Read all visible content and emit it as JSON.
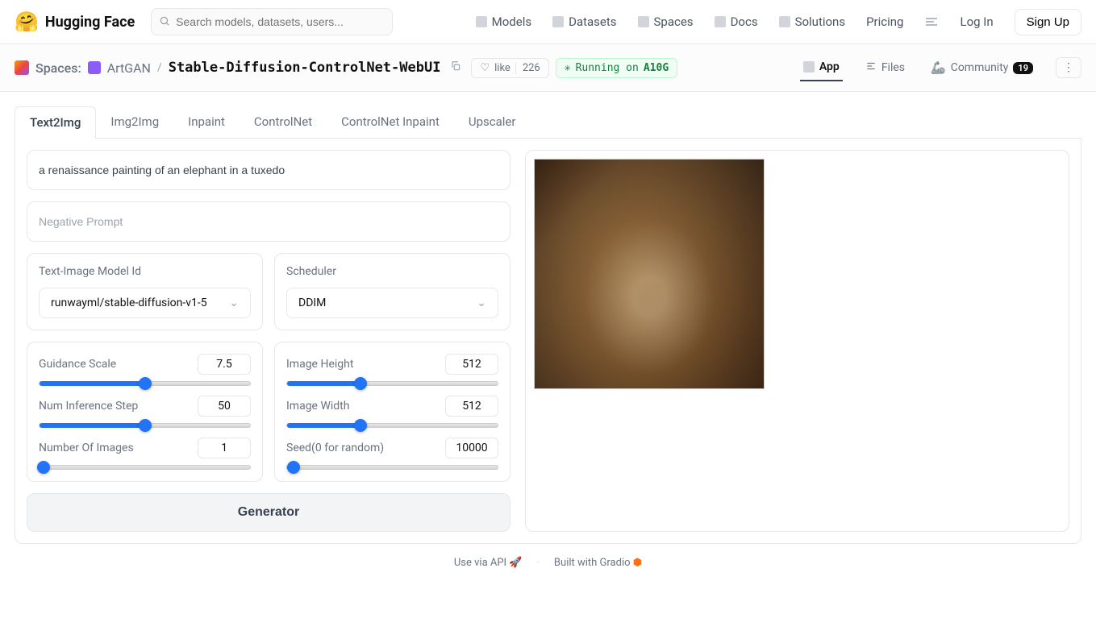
{
  "header": {
    "brand": "Hugging Face",
    "search_placeholder": "Search models, datasets, users...",
    "nav": {
      "models": "Models",
      "datasets": "Datasets",
      "spaces": "Spaces",
      "docs": "Docs",
      "solutions": "Solutions",
      "pricing": "Pricing",
      "login": "Log In",
      "signup": "Sign Up"
    }
  },
  "spacebar": {
    "label": "Spaces:",
    "owner": "ArtGAN",
    "name": "Stable-Diffusion-ControlNet-WebUI",
    "like_label": "like",
    "like_count": "226",
    "running_prefix": "Running on",
    "running_hw": "A10G",
    "tabs": {
      "app": "App",
      "files": "Files",
      "community": "Community",
      "community_count": "19"
    }
  },
  "tabs": {
    "text2img": "Text2Img",
    "img2img": "Img2Img",
    "inpaint": "Inpaint",
    "controlnet": "ControlNet",
    "controlnet_inpaint": "ControlNet Inpaint",
    "upscaler": "Upscaler"
  },
  "form": {
    "prompt_value": "a renaissance painting of an elephant in a tuxedo",
    "negative_placeholder": "Negative Prompt",
    "model_label": "Text-Image Model Id",
    "model_value": "runwayml/stable-diffusion-v1-5",
    "scheduler_label": "Scheduler",
    "scheduler_value": "DDIM",
    "guidance": {
      "label": "Guidance Scale",
      "value": "7.5",
      "pct": 50
    },
    "steps": {
      "label": "Num Inference Step",
      "value": "50",
      "pct": 50
    },
    "num_images": {
      "label": "Number Of Images",
      "value": "1",
      "pct": 2
    },
    "height": {
      "label": "Image Height",
      "value": "512",
      "pct": 35
    },
    "width": {
      "label": "Image Width",
      "value": "512",
      "pct": 35
    },
    "seed": {
      "label": "Seed(0 for random)",
      "value": "10000",
      "pct": 3
    },
    "generate": "Generator"
  },
  "footer": {
    "api": "Use via API",
    "gradio": "Built with Gradio"
  }
}
